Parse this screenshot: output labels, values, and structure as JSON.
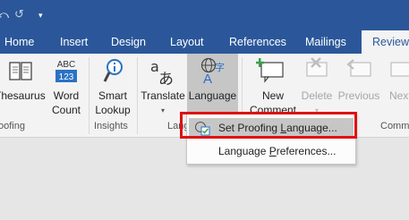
{
  "quick_access": {
    "undo_icon": "undo-arrow",
    "redo_icon": "redo-circular-arrow",
    "customize_icon": "customize-toolbar"
  },
  "tabs": [
    "Home",
    "Insert",
    "Design",
    "Layout",
    "References",
    "Mailings",
    "Review"
  ],
  "active_tab": "Review",
  "ribbon": {
    "thesaurus": "Thesaurus",
    "word_count_line1": "Word",
    "word_count_line2": "Count",
    "word_count_badge": "ABC\n123",
    "smart_lookup_line1": "Smart",
    "smart_lookup_line2": "Lookup",
    "translate": "Translate",
    "language": "Language",
    "new_comment_line1": "New",
    "new_comment_line2": "Comment",
    "delete": "Delete",
    "previous": "Previous",
    "next": "Next",
    "groups": {
      "proofing": "oofing",
      "insights": "Insights",
      "language": "Lang",
      "comments": "Comm"
    }
  },
  "menu": {
    "set_proofing_pre": "Set Proofing ",
    "set_proofing_u": "L",
    "set_proofing_post": "anguage...",
    "lang_prefs_pre": "Language ",
    "lang_prefs_u": "P",
    "lang_prefs_post": "references..."
  },
  "colors": {
    "title_bar": "#2b579a",
    "ribbon_bg": "#f3f3f3",
    "highlight": "#c6c6c6",
    "callout": "#e01010"
  }
}
